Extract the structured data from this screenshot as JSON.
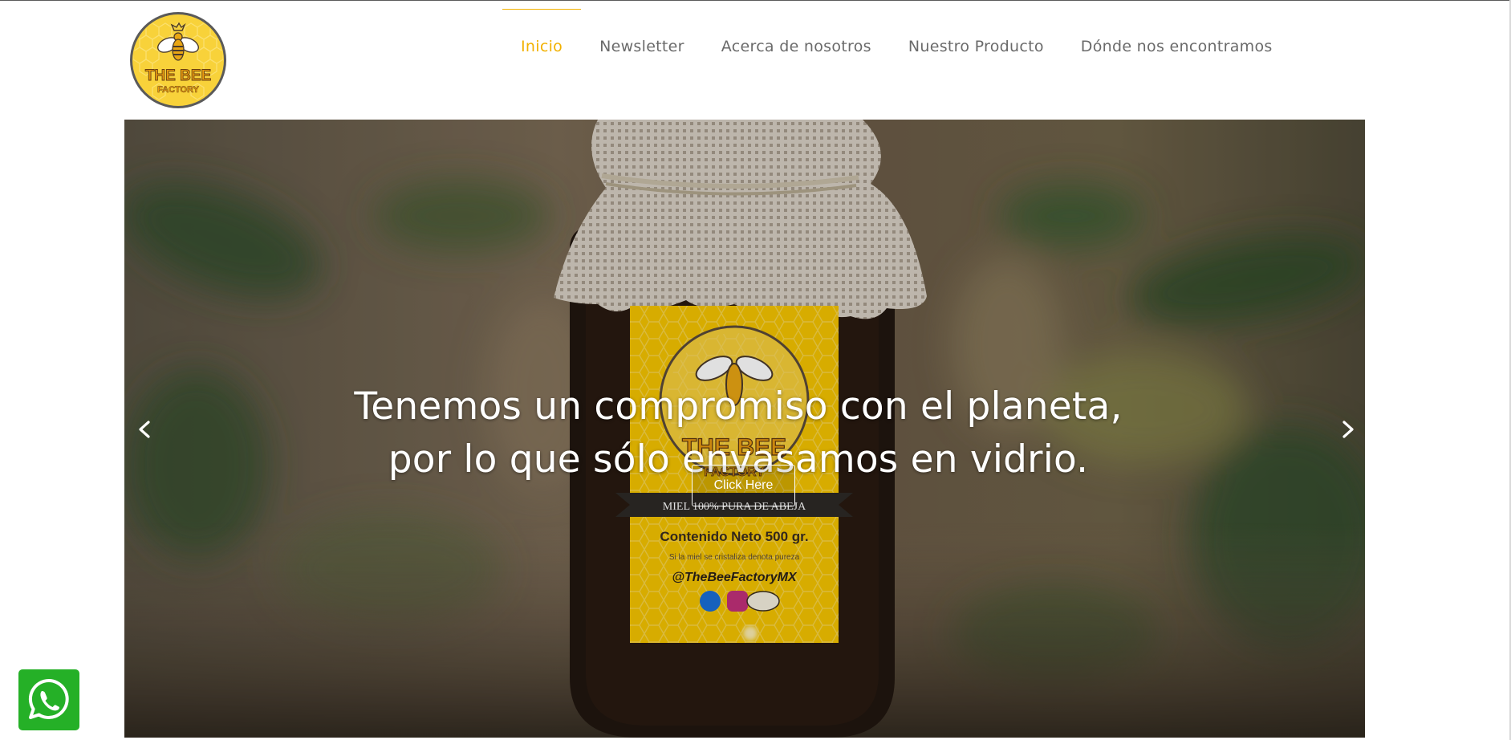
{
  "header": {
    "logo": {
      "brand_line1": "THE BEE",
      "brand_line2": "FACTORY",
      "icon": "bee-logo-icon"
    },
    "nav": [
      {
        "label": "Inicio",
        "active": true
      },
      {
        "label": "Newsletter",
        "active": false
      },
      {
        "label": "Acerca de nosotros",
        "active": false
      },
      {
        "label": "Nuestro Producto",
        "active": false
      },
      {
        "label": "Dónde nos encontramos",
        "active": false
      }
    ]
  },
  "slider": {
    "caption": "Tenemos un compromiso con el planeta, por lo que sólo envasamos en vidrio.",
    "cta_label": "Click Here",
    "prev_icon": "chevron-left-icon",
    "next_icon": "chevron-right-icon",
    "jar_label": {
      "brand_line1": "THE BEE",
      "brand_line2": "FACTORY",
      "banner": "MIEL 100% PURA DE ABEJA",
      "content": "Contenido Neto 500 gr.",
      "note": "Si la miel se cristaliza denota pureza",
      "handle": "@TheBeeFactoryMX"
    }
  },
  "whatsapp": {
    "icon": "whatsapp-icon"
  },
  "colors": {
    "accent": "#f2b100",
    "nav_text": "#6a6a6a",
    "whatsapp_green": "#25b027",
    "honey_yellow": "#f5c400"
  }
}
